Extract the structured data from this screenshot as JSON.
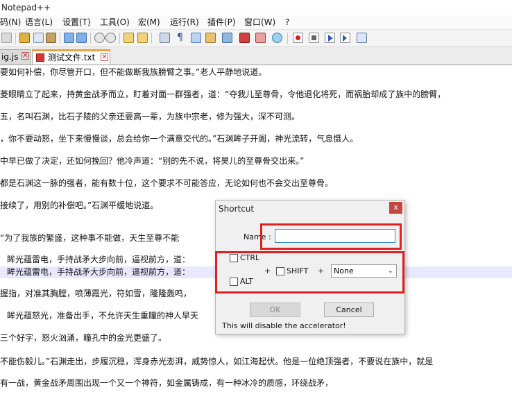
{
  "app": {
    "title": "Notepad++"
  },
  "menu": [
    "码(N)",
    "语言(L)",
    "设置(T)",
    "工具(O)",
    "宏(M)",
    "运行(R)",
    "插件(P)",
    "窗口(W)",
    "?"
  ],
  "tabs": [
    {
      "label": "ig.js",
      "active": false
    },
    {
      "label": "测试文件.txt",
      "active": true
    }
  ],
  "editor": {
    "lines": [
      "要如何补偿，你尽管开口，但不能做断我族膀臂之事。”老人平静地说道。",
      "菱眼睛立了起来，持黄金战矛而立，盯着对面一群强者，道：“夺我儿至尊骨，令他退化将死，而祸胎却成了族中的膀臂，",
      "五，名叫石渊，比石子陵的父亲还要高一辈，为族中宗老，修为强大，深不可测。",
      "，你不要动怒，坐下来慢慢谈，总会给你一个满意交代的。”石渊眸子开阖，神光流转，气息慑人。",
      "中早已做了决定，还如何挽回？他冷声道：“别的先不说，将昊儿的至尊骨交出来。”",
      "都是石渊这一脉的强者，能有数十位，这个要求不可能答应，无论如何也不会交出至尊骨。",
      "接续了，用别的补偿吧。”石渊平缓地说道。",
      "",
      "“为了我族的繁盛，这种事不能做，天生至尊不能",
      "眸光蕴雷电，手持战矛大步向前，逼视前方，道：",
      "眸光蕴雷电，手持战矛大步向前，逼视前方，道：",
      "握指，对准其胸膛，喷薄霞光，符如雪，隆隆轰鸣，",
      "",
      "眸光蕴怒光，准备出手，不允许天生重瞳的神人早天",
      "三个好字，怒火汹涌，瞳孔中的金光更盛了。",
      "不能伤毅儿。”石渊走出，步履沉稳，浑身赤光澎湃，威势惊人，如江海起伏。他是一位绝顶强者，不要说在族中，就是",
      "有一战，黄金战矛周围出现一个又一个神符，如金属铸成，有一种冰冷的质感，环绕战矛，"
    ]
  },
  "dialog": {
    "title": "Shortcut",
    "close": "x",
    "name_label": "Name :",
    "name_value": "",
    "ctrl_label": "CTRL",
    "alt_label": "ALT",
    "plus1": "+",
    "plus2": "+",
    "shift_label": "SHIFT",
    "key_value": "None",
    "ok_label": "OK",
    "cancel_label": "Cancel",
    "info": "This will disable the accelerator!",
    "ok_enabled": false
  },
  "colors": {
    "highlight": "#e02020",
    "current_line": "#e8e8ff",
    "tab_accent": "#f0a23a"
  }
}
